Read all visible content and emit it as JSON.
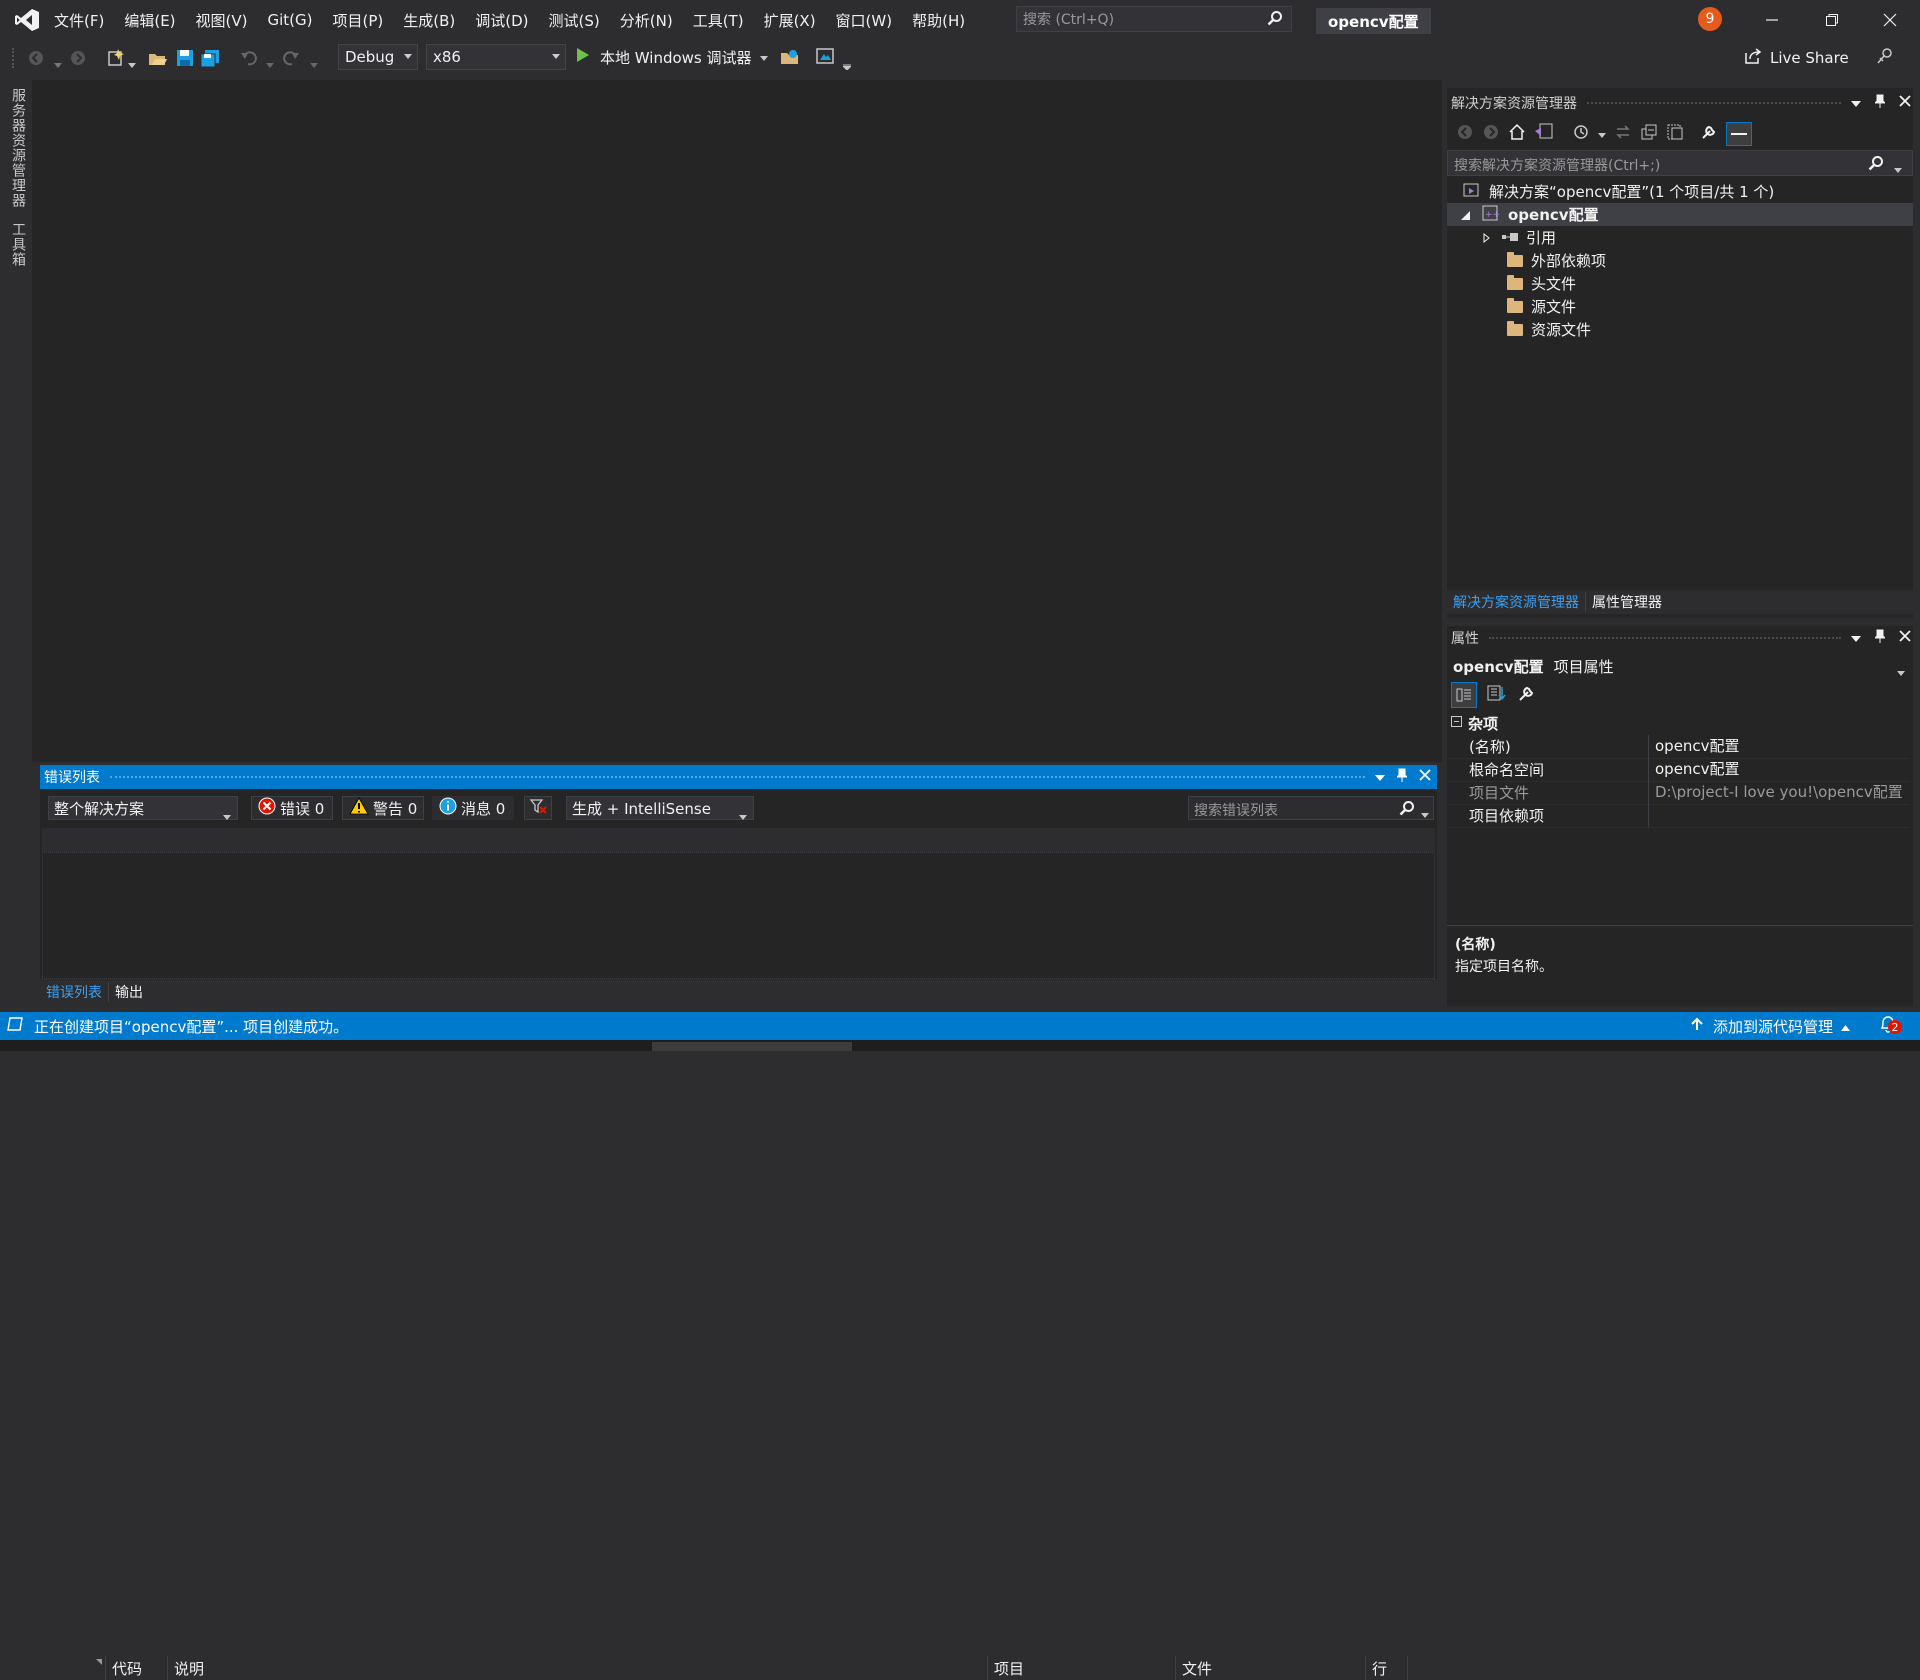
{
  "menu": {
    "items": [
      "文件(F)",
      "编辑(E)",
      "视图(V)",
      "Git(G)",
      "项目(P)",
      "生成(B)",
      "调试(D)",
      "测试(S)",
      "分析(N)",
      "工具(T)",
      "扩展(X)",
      "窗口(W)",
      "帮助(H)"
    ],
    "search_placeholder": "搜索 (Ctrl+Q)",
    "window_title": "opencv配置",
    "notification_count": "9"
  },
  "toolbar": {
    "config": "Debug",
    "platform": "x86",
    "run_label": "本地 Windows 调试器",
    "live_share": "Live Share"
  },
  "left_tabs": [
    "服务器资源管理器",
    "工具箱"
  ],
  "solution_explorer": {
    "title": "解决方案资源管理器",
    "search_placeholder": "搜索解决方案资源管理器(Ctrl+;)",
    "solution": "解决方案“opencv配置”(1 个项目/共 1 个)",
    "project": "opencv配置",
    "references": "引用",
    "folders": [
      "外部依赖项",
      "头文件",
      "源文件",
      "资源文件"
    ],
    "tabs": [
      "解决方案资源管理器",
      "属性管理器"
    ]
  },
  "properties": {
    "title": "属性",
    "object_name": "opencv配置",
    "object_type": "项目属性",
    "category": "杂项",
    "rows": [
      {
        "key": "(名称)",
        "value": "opencv配置"
      },
      {
        "key": "根命名空间",
        "value": "opencv配置"
      },
      {
        "key": "项目文件",
        "value": "D:\\project-I love you!\\opencv配置"
      },
      {
        "key": "项目依赖项",
        "value": ""
      }
    ],
    "desc_title": "(名称)",
    "desc_text": "指定项目名称。"
  },
  "error_list": {
    "title": "错误列表",
    "scope": "整个解决方案",
    "errors": "错误 0",
    "warnings": "警告 0",
    "messages": "消息 0",
    "build_filter": "生成 + IntelliSense",
    "search_placeholder": "搜索错误列表",
    "columns": [
      "代码",
      "说明",
      "项目",
      "文件",
      "行"
    ],
    "tabs": [
      "错误列表",
      "输出"
    ]
  },
  "statusbar": {
    "message": "正在创建项目“opencv配置”... 项目创建成功。",
    "source_control": "添加到源代码管理",
    "notif_count": "2"
  },
  "colors": {
    "accent": "#007acc",
    "background": "#2d2d30",
    "panel": "#252526",
    "error_red": "#e51400",
    "warning_yellow": "#ffcc00",
    "info_blue": "#1ba1e2",
    "badge_orange": "#e85a1b"
  }
}
